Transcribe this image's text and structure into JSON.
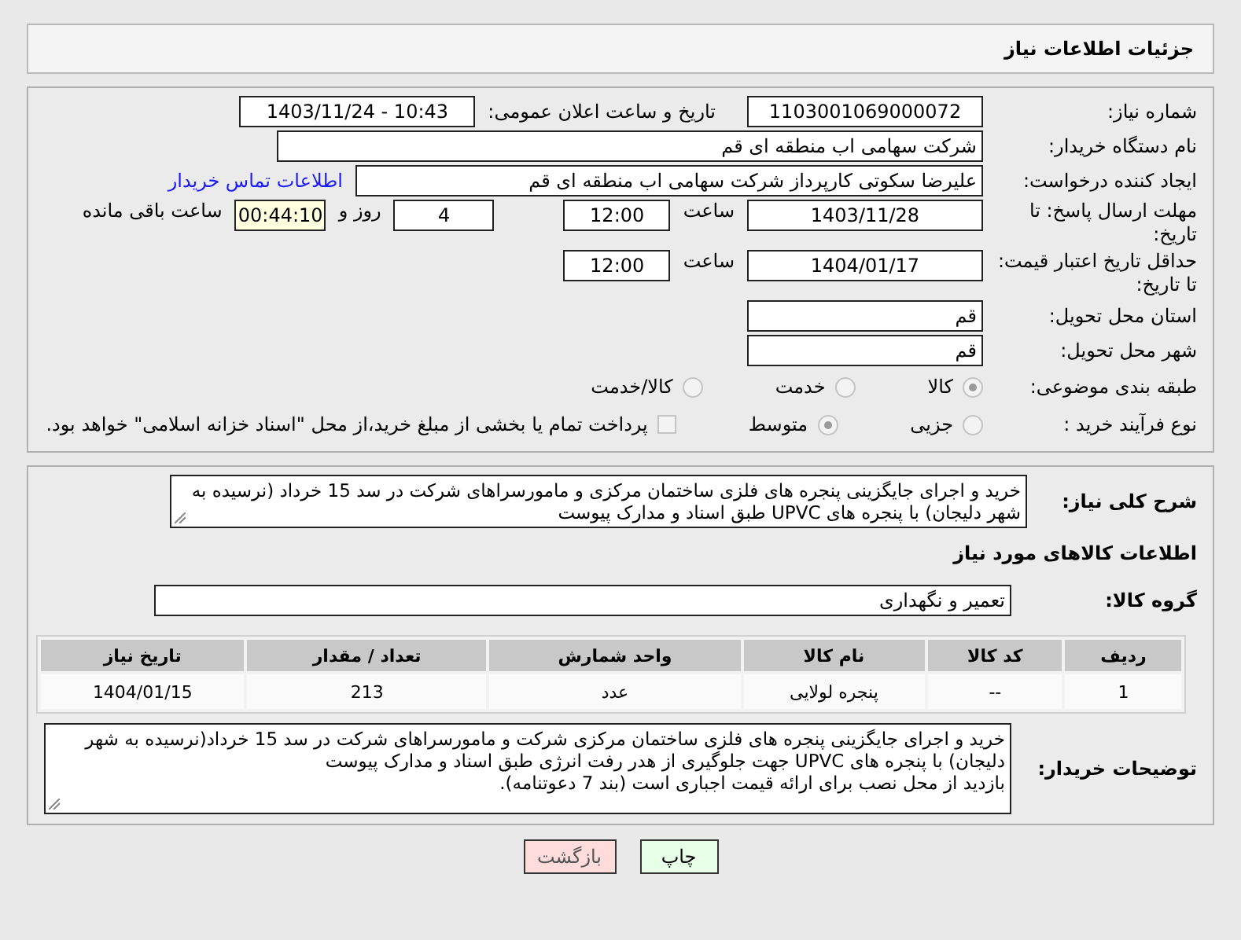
{
  "header": {
    "title": "جزئیات اطلاعات نیاز"
  },
  "need_number": {
    "label": "شماره نیاز:",
    "value": "1103001069000072"
  },
  "announce": {
    "label": "تاریخ و ساعت اعلان عمومی:",
    "value": "1403/11/24 - 10:43"
  },
  "buyer_org": {
    "label": "نام دستگاه خریدار:",
    "value": "شرکت سهامی اب منطقه ای قم"
  },
  "requester": {
    "label": "ایجاد کننده درخواست:",
    "value": "علیرضا سکوتی کارپرداز شرکت سهامی اب منطقه ای قم",
    "link": "اطلاعات تماس خریدار"
  },
  "reply_deadline": {
    "label": "مهلت ارسال پاسخ: تا تاریخ:",
    "date": "1403/11/28",
    "time_label": "ساعت",
    "time": "12:00",
    "days": "4",
    "days_label": "روز و",
    "remaining": "00:44:10",
    "remaining_label": "ساعت باقی مانده"
  },
  "price_validity": {
    "label": "حداقل تاریخ اعتبار قیمت: تا تاریخ:",
    "date": "1404/01/17",
    "time_label": "ساعت",
    "time": "12:00"
  },
  "province": {
    "label": "استان محل تحویل:",
    "value": "قم"
  },
  "city": {
    "label": "شهر محل تحویل:",
    "value": "قم"
  },
  "category": {
    "label": "طبقه بندی موضوعی:",
    "options": [
      {
        "label": "کالا",
        "selected": true
      },
      {
        "label": "خدمت",
        "selected": false
      },
      {
        "label": "کالا/خدمت",
        "selected": false
      }
    ]
  },
  "process": {
    "label": "نوع فرآیند خرید :",
    "options": [
      {
        "label": "جزیی",
        "selected": false
      },
      {
        "label": "متوسط",
        "selected": true
      }
    ],
    "payment": {
      "label": "پرداخت تمام یا بخشی از مبلغ خرید،از محل \"اسناد خزانه اسلامی\" خواهد بود.",
      "checked": false
    }
  },
  "summary": {
    "label": "شرح کلی نیاز:",
    "text": "خرید و اجرای جایگزینی پنجره های فلزی ساختمان مرکزی و مامورسراهای شرکت در سد 15 خرداد (نرسیده به شهر دلیجان) با پنجره های UPVC طبق اسناد و مدارک پیوست"
  },
  "items_heading": "اطلاعات کالاهای مورد نیاز",
  "goods_group": {
    "label": "گروه کالا:",
    "value": "تعمیر و نگهداری"
  },
  "table": {
    "columns": [
      "ردیف",
      "کد کالا",
      "نام کالا",
      "واحد شمارش",
      "تعداد / مقدار",
      "تاریخ نیاز"
    ],
    "rows": [
      [
        "1",
        "--",
        "پنجره لولایی",
        "عدد",
        "213",
        "1404/01/15"
      ]
    ]
  },
  "buyer_notes": {
    "label": "توضیحات خریدار:",
    "paragraphs": [
      "خرید و اجرای جایگزینی پنجره های فلزی ساختمان مرکزی شرکت و مامورسراهای شرکت در سد 15 خرداد(نرسیده به شهر دلیجان) با پنجره های UPVC جهت جلوگیری از هدر رفت انرژی طبق اسناد و مدارک پیوست",
      "بازدید از محل نصب برای ارائه قیمت اجباری است (بند 7  دعوتنامه)."
    ]
  },
  "buttons": [
    {
      "label": "چاپ",
      "kind": "print"
    },
    {
      "label": "بازگشت",
      "kind": "back"
    }
  ]
}
